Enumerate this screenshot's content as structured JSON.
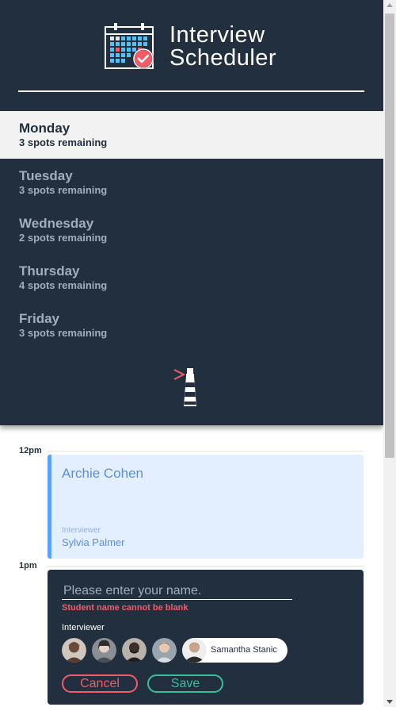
{
  "brand": {
    "title_line1": "Interview",
    "title_line2": "Scheduler",
    "logo_icon": "calendar-check-icon"
  },
  "days": [
    {
      "name": "Monday",
      "spots": "3 spots remaining",
      "selected": true
    },
    {
      "name": "Tuesday",
      "spots": "3 spots remaining",
      "selected": false
    },
    {
      "name": "Wednesday",
      "spots": "2 spots remaining",
      "selected": false
    },
    {
      "name": "Thursday",
      "spots": "4 spots remaining",
      "selected": false
    },
    {
      "name": "Friday",
      "spots": "3 spots remaining",
      "selected": false
    }
  ],
  "footer_icon": "lighthouse-icon",
  "schedule": {
    "slots": [
      {
        "time": "12pm",
        "student": "Archie Cohen",
        "interviewer_caption": "Interviewer",
        "interviewer": "Sylvia Palmer"
      },
      {
        "time": "1pm",
        "form": {
          "placeholder": "Please enter your name.",
          "value": "",
          "error": "Student name cannot be blank",
          "interviewer_heading": "Interviewer",
          "interviewers": [
            {
              "name": "",
              "avatar_color": "#6b4a3a",
              "selected": false
            },
            {
              "name": "",
              "avatar_color": "#8a8f96",
              "selected": false
            },
            {
              "name": "",
              "avatar_color": "#3a2f2a",
              "selected": false
            },
            {
              "name": "",
              "avatar_color": "#9aa4ae",
              "selected": false
            },
            {
              "name": "Samantha Stanic",
              "avatar_color": "#5a4636",
              "selected": true
            }
          ],
          "cancel_label": "Cancel",
          "save_label": "Save"
        }
      }
    ]
  },
  "colors": {
    "sidebar": "#222f3e",
    "selected_day_bg": "#f2f2f2",
    "appointment_bg": "#e3efff",
    "appointment_accent": "#5aa1ff",
    "danger": "#f25c68",
    "success": "#37c097"
  }
}
